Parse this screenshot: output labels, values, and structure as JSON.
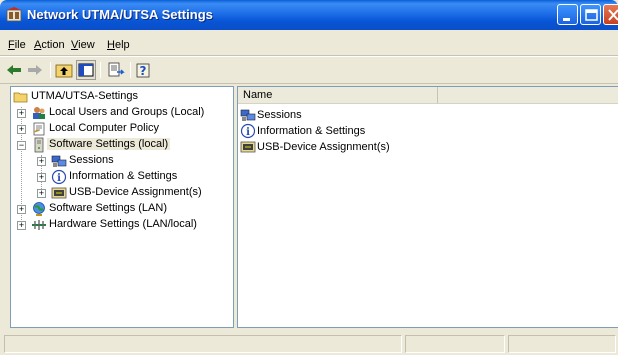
{
  "window": {
    "title": "Network UTMA/UTSA Settings",
    "title_bar_color": "#0a5fd8"
  },
  "menu": [
    {
      "label": "File",
      "accel": "F",
      "rest": "ile"
    },
    {
      "label": "Action",
      "accel": "A",
      "rest": "ction"
    },
    {
      "label": "View",
      "accel": "V",
      "rest": "iew"
    },
    {
      "label": "Help",
      "accel": "H",
      "rest": "elp"
    }
  ],
  "toolbar": {
    "buttons": [
      {
        "name": "back-button",
        "icon": "back-arrow-icon"
      },
      {
        "name": "forward-button",
        "icon": "forward-arrow-icon"
      },
      {
        "name": "up-one-level-button",
        "icon": "folder-up-icon"
      },
      {
        "name": "show-hide-console-tree-button",
        "icon": "console-tree-icon"
      },
      {
        "name": "export-list-button",
        "icon": "export-list-icon"
      },
      {
        "name": "help-button",
        "icon": "help-icon"
      }
    ]
  },
  "tree": {
    "root": "UTMA/UTSA-Settings",
    "items": [
      {
        "label": "Local Users and Groups (Local)",
        "icon": "users-icon",
        "expander": "+"
      },
      {
        "label": "Local Computer Policy",
        "icon": "policy-icon",
        "expander": "+"
      },
      {
        "label": "Software Settings (local)",
        "icon": "server-icon",
        "expander": "−",
        "selected": true
      },
      {
        "label": "Sessions",
        "icon": "sessions-icon",
        "expander": "+",
        "child": true
      },
      {
        "label": "Information & Settings",
        "icon": "info-icon",
        "expander": "+",
        "child": true
      },
      {
        "label": "USB-Device Assignment(s)",
        "icon": "usb-device-icon",
        "expander": "+",
        "child": true
      },
      {
        "label": "Software Settings (LAN)",
        "icon": "globe-icon",
        "expander": "+"
      },
      {
        "label": "Hardware Settings (LAN/local)",
        "icon": "network-icon",
        "expander": "+"
      }
    ]
  },
  "list": {
    "column": "Name",
    "rows": [
      {
        "label": "Sessions",
        "icon": "sessions-icon"
      },
      {
        "label": "Information & Settings",
        "icon": "info-icon"
      },
      {
        "label": "USB-Device Assignment(s)",
        "icon": "usb-device-icon"
      }
    ]
  }
}
